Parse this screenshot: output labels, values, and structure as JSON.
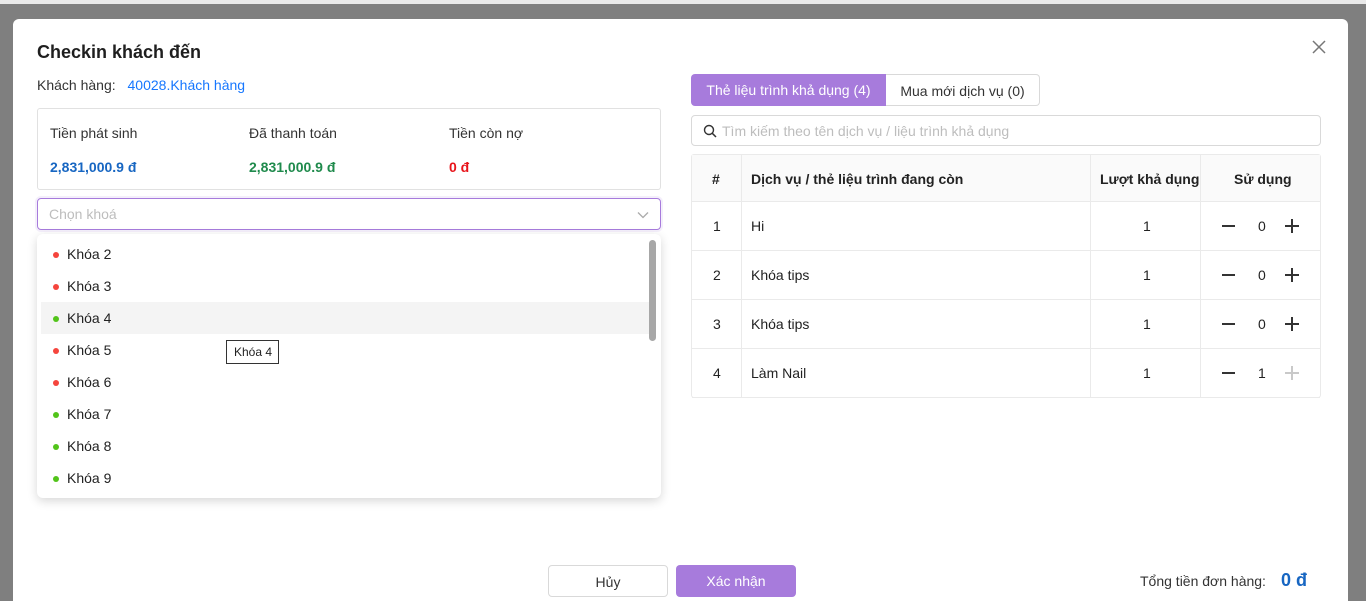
{
  "modal": {
    "title": "Checkin khách đến",
    "customer_label": "Khách hàng:",
    "customer_value": "40028.Khách hàng"
  },
  "summary": {
    "incurred_label": "Tiền phát sinh",
    "incurred_value": "2,831,000.9 đ",
    "paid_label": "Đã thanh toán",
    "paid_value": "2,831,000.9 đ",
    "debt_label": "Tiền còn nợ",
    "debt_value": "0 đ",
    "colors": {
      "incurred": "#1766c2",
      "paid": "#1f8a4c",
      "debt": "#e8141a"
    }
  },
  "course_select": {
    "placeholder": "Chọn khoá",
    "options": [
      {
        "label": "Khóa 2",
        "status": "red"
      },
      {
        "label": "Khóa 3",
        "status": "red"
      },
      {
        "label": "Khóa 4",
        "status": "green"
      },
      {
        "label": "Khóa 5",
        "status": "red"
      },
      {
        "label": "Khóa 6",
        "status": "red"
      },
      {
        "label": "Khóa 7",
        "status": "green"
      },
      {
        "label": "Khóa 8",
        "status": "green"
      },
      {
        "label": "Khóa 9",
        "status": "green"
      }
    ],
    "hovered_index": 2,
    "tooltip": "Khóa 4"
  },
  "tabs": [
    {
      "label": "Thẻ liệu trình khả dụng (4)",
      "active": true
    },
    {
      "label": "Mua mới dịch vụ (0)",
      "active": false
    }
  ],
  "search": {
    "placeholder": "Tìm kiếm theo tên dịch vụ / liệu trình khả dụng"
  },
  "table": {
    "headers": [
      "#",
      "Dịch vụ / thẻ liệu trình đang còn",
      "Lượt khả dụng",
      "Sử dụng"
    ],
    "rows": [
      {
        "no": "1",
        "service": "Hi",
        "available": "1",
        "use": "0",
        "plus_disabled": false
      },
      {
        "no": "2",
        "service": "Khóa tips",
        "available": "1",
        "use": "0",
        "plus_disabled": false
      },
      {
        "no": "3",
        "service": "Khóa tips",
        "available": "1",
        "use": "0",
        "plus_disabled": false
      },
      {
        "no": "4",
        "service": "Làm Nail",
        "available": "1",
        "use": "1",
        "plus_disabled": true
      }
    ]
  },
  "footer": {
    "cancel_label": "Hủy",
    "confirm_label": "Xác nhận",
    "total_label": "Tổng tiền đơn hàng:",
    "total_value": "0 đ"
  },
  "icons": {
    "close": "close-icon",
    "chevron": "chevron-down-icon",
    "search": "search-icon",
    "minus": "minus-icon",
    "plus": "plus-icon"
  },
  "colors": {
    "accent": "#a77bdc",
    "link": "#1677ff",
    "status_red": "#f5453d",
    "status_green": "#52c41a"
  }
}
